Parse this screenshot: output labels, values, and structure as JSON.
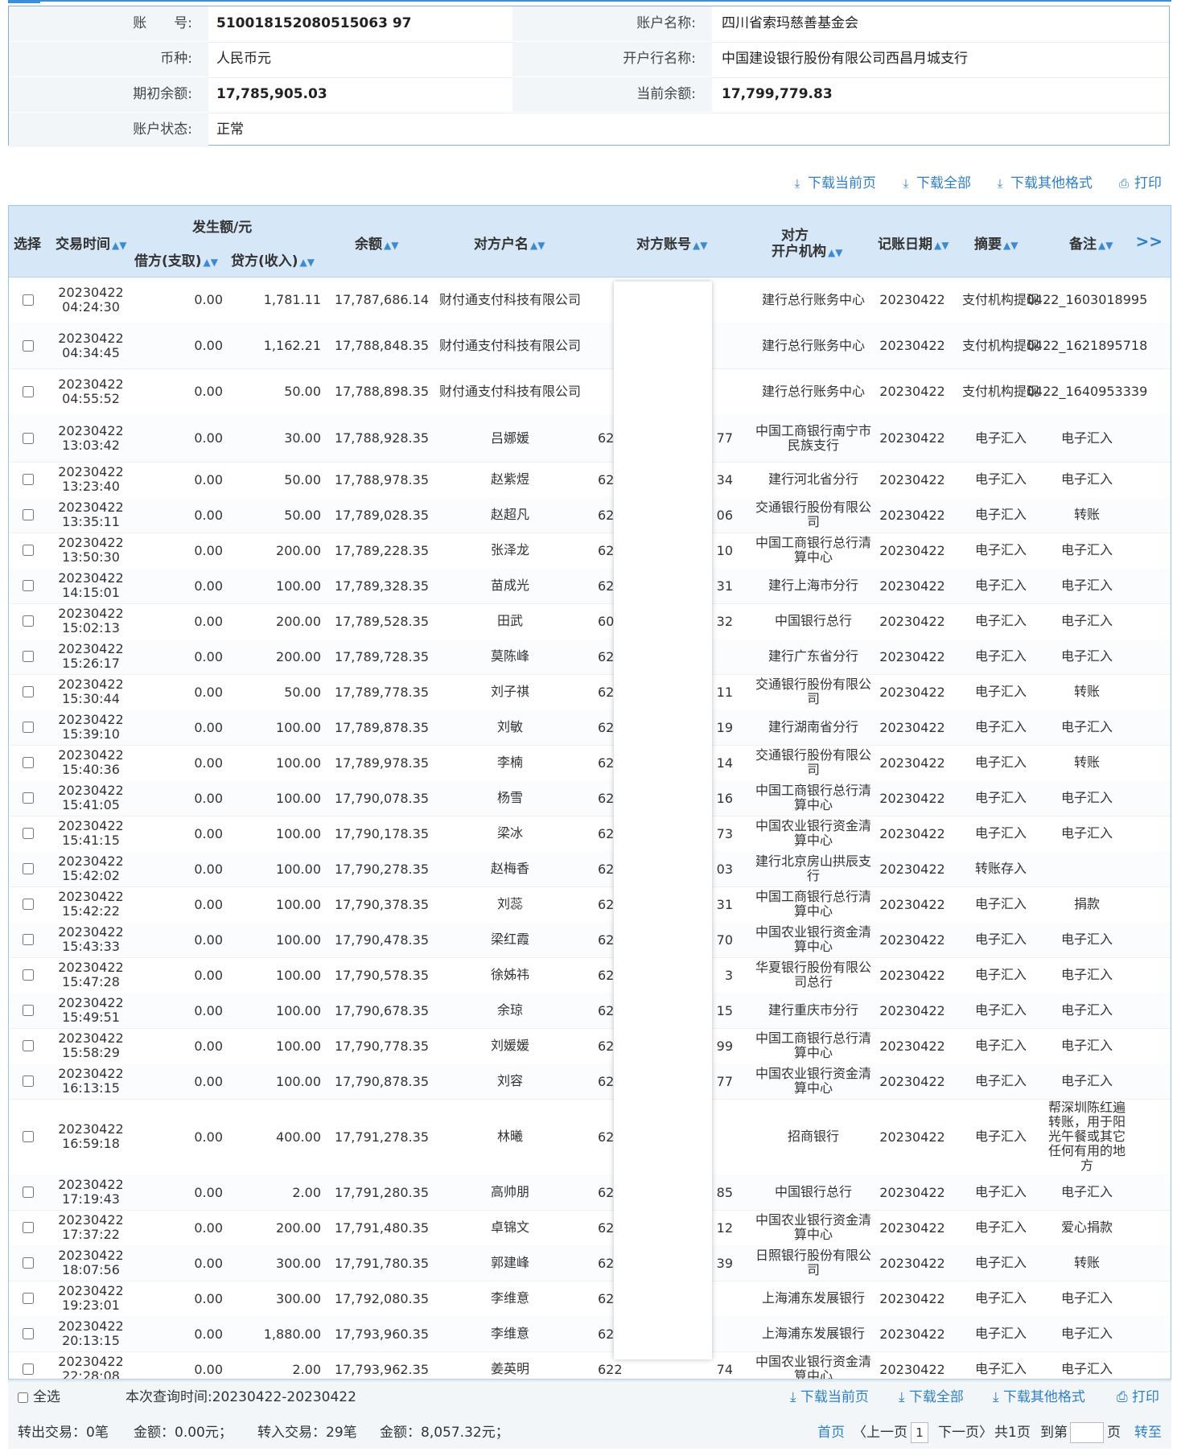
{
  "account_info": {
    "account_no_label": "账　　号:",
    "account_no": "510018152080515063 97",
    "account_name_label": "账户名称:",
    "account_name": "四川省索玛慈善基金会",
    "currency_label": "币种:",
    "currency": "人民币元",
    "bank_label": "开户行名称:",
    "bank": "中国建设银行股份有限公司西昌月城支行",
    "opening_balance_label": "期初余额:",
    "opening_balance": "17,785,905.03",
    "current_balance_label": "当前余额:",
    "current_balance": "17,799,779.83",
    "status_label": "账户状态:",
    "status": "正常"
  },
  "toolbar": {
    "download_page": "下载当前页",
    "download_all": "下载全部",
    "download_other": "下载其他格式",
    "print": "打印"
  },
  "table": {
    "headers": {
      "select": "选择",
      "time": "交易时间",
      "amount_group": "发生额/元",
      "debit": "借方(支取)",
      "credit": "贷方(收入)",
      "balance": "余额",
      "counterparty_name": "对方户名",
      "counterparty_account": "对方账号",
      "counterparty_org_1": "对方",
      "counterparty_org_2": "开户机构",
      "post_date": "记账日期",
      "summary": "摘要",
      "note": "备注",
      "more": ">>"
    },
    "rows": [
      {
        "date": "20230422",
        "time": "04:24:30",
        "debit": "0.00",
        "credit": "1,781.11",
        "balance": "17,787,686.14",
        "name": "财付通支付科技有限公司",
        "acct_l": "",
        "acct_r": "",
        "org": "建行总行账务中心",
        "post": "20230422",
        "summary": "支付机构提现",
        "note": "0422_1603018995"
      },
      {
        "date": "20230422",
        "time": "04:34:45",
        "debit": "0.00",
        "credit": "1,162.21",
        "balance": "17,788,848.35",
        "name": "财付通支付科技有限公司",
        "acct_l": "",
        "acct_r": "",
        "org": "建行总行账务中心",
        "post": "20230422",
        "summary": "支付机构提现",
        "note": "0422_1621895718"
      },
      {
        "date": "20230422",
        "time": "04:55:52",
        "debit": "0.00",
        "credit": "50.00",
        "balance": "17,788,898.35",
        "name": "财付通支付科技有限公司",
        "acct_l": "",
        "acct_r": "",
        "org": "建行总行账务中心",
        "post": "20230422",
        "summary": "支付机构提现",
        "note": "0422_1640953339"
      },
      {
        "date": "20230422",
        "time": "13:03:42",
        "debit": "0.00",
        "credit": "30.00",
        "balance": "17,788,928.35",
        "name": "吕娜媛",
        "acct_l": "622",
        "acct_r": "77",
        "org": "中国工商银行南宁市民族支行",
        "post": "20230422",
        "summary": "电子汇入",
        "note": "电子汇入"
      },
      {
        "date": "20230422",
        "time": "13:23:40",
        "debit": "0.00",
        "credit": "50.00",
        "balance": "17,788,978.35",
        "name": "赵紫煜",
        "acct_l": "621",
        "acct_r": "34",
        "org": "建行河北省分行",
        "post": "20230422",
        "summary": "电子汇入",
        "note": "电子汇入"
      },
      {
        "date": "20230422",
        "time": "13:35:11",
        "debit": "0.00",
        "credit": "50.00",
        "balance": "17,789,028.35",
        "name": "赵超凡",
        "acct_l": "622",
        "acct_r": "06",
        "org": "交通银行股份有限公司",
        "post": "20230422",
        "summary": "电子汇入",
        "note": "转账"
      },
      {
        "date": "20230422",
        "time": "13:50:30",
        "debit": "0.00",
        "credit": "200.00",
        "balance": "17,789,228.35",
        "name": "张泽龙",
        "acct_l": "622",
        "acct_r": "10",
        "org": "中国工商银行总行清算中心",
        "post": "20230422",
        "summary": "电子汇入",
        "note": "电子汇入"
      },
      {
        "date": "20230422",
        "time": "14:15:01",
        "debit": "0.00",
        "credit": "100.00",
        "balance": "17,789,328.35",
        "name": "苗成光",
        "acct_l": "621",
        "acct_r": "31",
        "org": "建行上海市分行",
        "post": "20230422",
        "summary": "电子汇入",
        "note": "电子汇入"
      },
      {
        "date": "20230422",
        "time": "15:02:13",
        "debit": "0.00",
        "credit": "200.00",
        "balance": "17,789,528.35",
        "name": "田武",
        "acct_l": "601",
        "acct_r": "32",
        "org": "中国银行总行",
        "post": "20230422",
        "summary": "电子汇入",
        "note": "电子汇入"
      },
      {
        "date": "20230422",
        "time": "15:26:17",
        "debit": "0.00",
        "credit": "200.00",
        "balance": "17,789,728.35",
        "name": "莫陈峰",
        "acct_l": "62",
        "acct_r": "",
        "org": "建行广东省分行",
        "post": "20230422",
        "summary": "电子汇入",
        "note": "电子汇入"
      },
      {
        "date": "20230422",
        "time": "15:30:44",
        "debit": "0.00",
        "credit": "50.00",
        "balance": "17,789,778.35",
        "name": "刘子祺",
        "acct_l": "622",
        "acct_r": "11",
        "org": "交通银行股份有限公司",
        "post": "20230422",
        "summary": "电子汇入",
        "note": "转账"
      },
      {
        "date": "20230422",
        "time": "15:39:10",
        "debit": "0.00",
        "credit": "100.00",
        "balance": "17,789,878.35",
        "name": "刘敏",
        "acct_l": "621",
        "acct_r": "19",
        "org": "建行湖南省分行",
        "post": "20230422",
        "summary": "电子汇入",
        "note": "电子汇入"
      },
      {
        "date": "20230422",
        "time": "15:40:36",
        "debit": "0.00",
        "credit": "100.00",
        "balance": "17,789,978.35",
        "name": "李楠",
        "acct_l": "622",
        "acct_r": "14",
        "org": "交通银行股份有限公司",
        "post": "20230422",
        "summary": "电子汇入",
        "note": "转账"
      },
      {
        "date": "20230422",
        "time": "15:41:05",
        "debit": "0.00",
        "credit": "100.00",
        "balance": "17,790,078.35",
        "name": "杨雪",
        "acct_l": "622",
        "acct_r": "16",
        "org": "中国工商银行总行清算中心",
        "post": "20230422",
        "summary": "电子汇入",
        "note": "电子汇入"
      },
      {
        "date": "20230422",
        "time": "15:41:15",
        "debit": "0.00",
        "credit": "100.00",
        "balance": "17,790,178.35",
        "name": "梁冰",
        "acct_l": "622",
        "acct_r": "73",
        "org": "中国农业银行资金清算中心",
        "post": "20230422",
        "summary": "电子汇入",
        "note": "电子汇入"
      },
      {
        "date": "20230422",
        "time": "15:42:02",
        "debit": "0.00",
        "credit": "100.00",
        "balance": "17,790,278.35",
        "name": "赵梅香",
        "acct_l": "623",
        "acct_r": "03",
        "org": "建行北京房山拱辰支行",
        "post": "20230422",
        "summary": "转账存入",
        "note": ""
      },
      {
        "date": "20230422",
        "time": "15:42:22",
        "debit": "0.00",
        "credit": "100.00",
        "balance": "17,790,378.35",
        "name": "刘蕊",
        "acct_l": "621",
        "acct_r": "31",
        "org": "中国工商银行总行清算中心",
        "post": "20230422",
        "summary": "电子汇入",
        "note": "捐款"
      },
      {
        "date": "20230422",
        "time": "15:43:33",
        "debit": "0.00",
        "credit": "100.00",
        "balance": "17,790,478.35",
        "name": "梁红霞",
        "acct_l": "623",
        "acct_r": "70",
        "org": "中国农业银行资金清算中心",
        "post": "20230422",
        "summary": "电子汇入",
        "note": "电子汇入"
      },
      {
        "date": "20230422",
        "time": "15:47:28",
        "debit": "0.00",
        "credit": "100.00",
        "balance": "17,790,578.35",
        "name": "徐姊祎",
        "acct_l": "62",
        "acct_r": "3",
        "org": "华夏银行股份有限公司总行",
        "post": "20230422",
        "summary": "电子汇入",
        "note": "电子汇入"
      },
      {
        "date": "20230422",
        "time": "15:49:51",
        "debit": "0.00",
        "credit": "100.00",
        "balance": "17,790,678.35",
        "name": "余琼",
        "acct_l": "622",
        "acct_r": "15",
        "org": "建行重庆市分行",
        "post": "20230422",
        "summary": "电子汇入",
        "note": "电子汇入"
      },
      {
        "date": "20230422",
        "time": "15:58:29",
        "debit": "0.00",
        "credit": "100.00",
        "balance": "17,790,778.35",
        "name": "刘媛媛",
        "acct_l": "622",
        "acct_r": "99",
        "org": "中国工商银行总行清算中心",
        "post": "20230422",
        "summary": "电子汇入",
        "note": "电子汇入"
      },
      {
        "date": "20230422",
        "time": "16:13:15",
        "debit": "0.00",
        "credit": "100.00",
        "balance": "17,790,878.35",
        "name": "刘容",
        "acct_l": "622",
        "acct_r": "77",
        "org": "中国农业银行资金清算中心",
        "post": "20230422",
        "summary": "电子汇入",
        "note": "电子汇入"
      },
      {
        "date": "20230422",
        "time": "16:59:18",
        "debit": "0.00",
        "credit": "400.00",
        "balance": "17,791,278.35",
        "name": "林曦",
        "acct_l": "62",
        "acct_r": "",
        "org": "招商银行",
        "post": "20230422",
        "summary": "电子汇入",
        "note": "帮深圳陈红遍转账，用于阳光午餐或其它任何有用的地方"
      },
      {
        "date": "20230422",
        "time": "17:19:43",
        "debit": "0.00",
        "credit": "2.00",
        "balance": "17,791,280.35",
        "name": "高帅朋",
        "acct_l": "621",
        "acct_r": "85",
        "org": "中国银行总行",
        "post": "20230422",
        "summary": "电子汇入",
        "note": "电子汇入"
      },
      {
        "date": "20230422",
        "time": "17:37:22",
        "debit": "0.00",
        "credit": "200.00",
        "balance": "17,791,480.35",
        "name": "卓锦文",
        "acct_l": "622",
        "acct_r": "12",
        "org": "中国农业银行资金清算中心",
        "post": "20230422",
        "summary": "电子汇入",
        "note": "爱心捐款"
      },
      {
        "date": "20230422",
        "time": "18:07:56",
        "debit": "0.00",
        "credit": "300.00",
        "balance": "17,791,780.35",
        "name": "郭建峰",
        "acct_l": "623",
        "acct_r": "39",
        "org": "日照银行股份有限公司",
        "post": "20230422",
        "summary": "电子汇入",
        "note": "转账"
      },
      {
        "date": "20230422",
        "time": "19:23:01",
        "debit": "0.00",
        "credit": "300.00",
        "balance": "17,792,080.35",
        "name": "李维意",
        "acct_l": "62",
        "acct_r": "",
        "org": "上海浦东发展银行",
        "post": "20230422",
        "summary": "电子汇入",
        "note": "电子汇入"
      },
      {
        "date": "20230422",
        "time": "20:13:15",
        "debit": "0.00",
        "credit": "1,880.00",
        "balance": "17,793,960.35",
        "name": "李维意",
        "acct_l": "62",
        "acct_r": "",
        "org": "上海浦东发展银行",
        "post": "20230422",
        "summary": "电子汇入",
        "note": "电子汇入"
      },
      {
        "date": "20230422",
        "time": "22:28:08",
        "debit": "0.00",
        "credit": "2.00",
        "balance": "17,793,962.35",
        "name": "姜英明",
        "acct_l": "622",
        "acct_r": "74",
        "org": "中国农业银行资金清算中心",
        "post": "20230422",
        "summary": "电子汇入",
        "note": "电子汇入"
      }
    ]
  },
  "footer": {
    "select_all": "全选",
    "query_time": "本次查询时间:20230422-20230422",
    "debit_count": "转出交易：0笔",
    "debit_amount": "金额：0.00元；",
    "credit_count": "转入交易：29笔",
    "credit_amount": "金额：8,057.32元；",
    "first": "首页",
    "prev": "〈上一页",
    "page": "1",
    "next": "下一页〉",
    "total": "共1页",
    "goto": "到第",
    "page_unit": "页",
    "go": "转至"
  }
}
